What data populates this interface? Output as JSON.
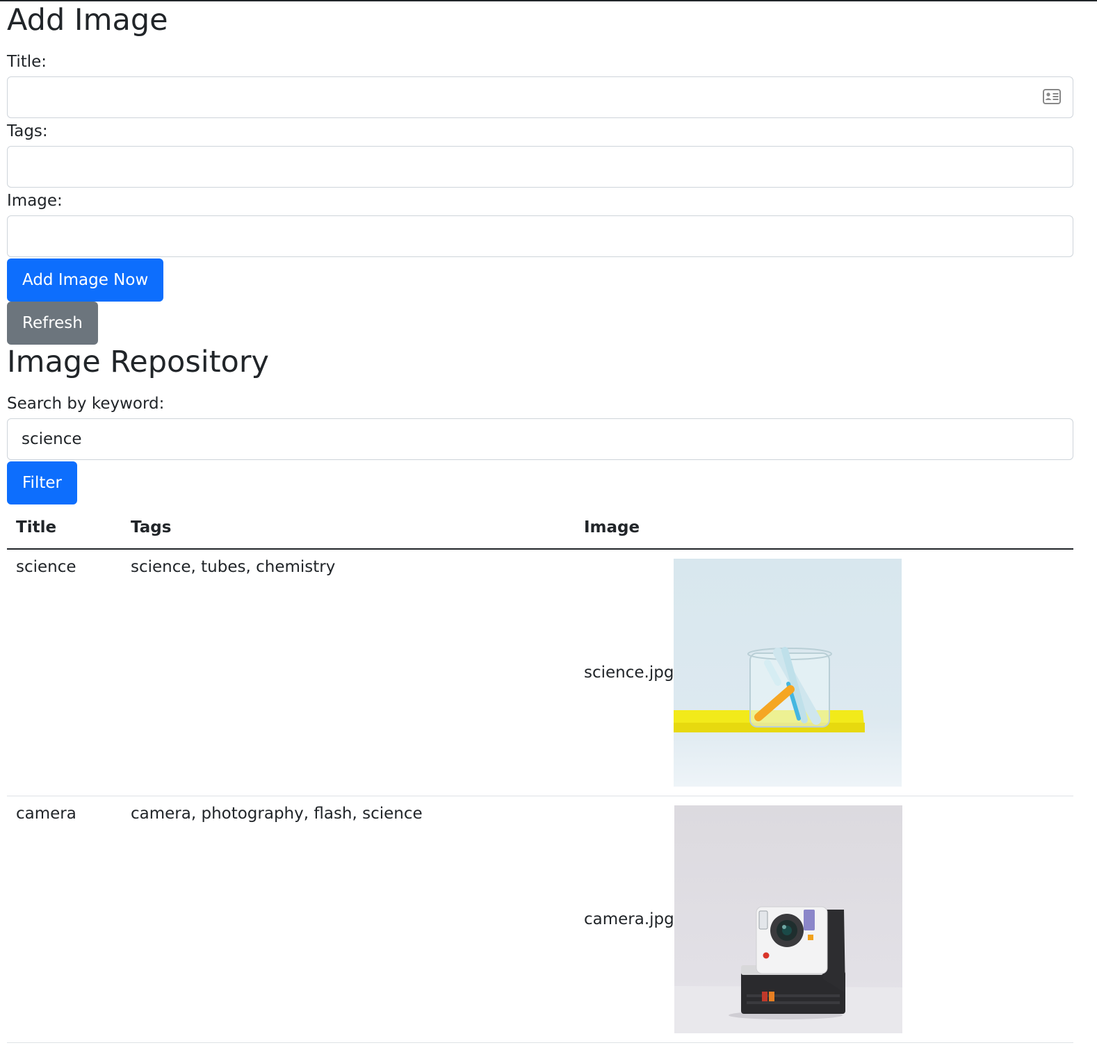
{
  "add_form": {
    "heading": "Add Image",
    "title_label": "Title:",
    "title_value": "",
    "tags_label": "Tags:",
    "tags_value": "",
    "image_label": "Image:",
    "image_value": "",
    "submit_label": "Add Image Now",
    "refresh_label": "Refresh"
  },
  "repository": {
    "heading": "Image Repository",
    "search_label": "Search by keyword:",
    "search_value": "science",
    "filter_label": "Filter",
    "columns": [
      "Title",
      "Tags",
      "Image"
    ],
    "rows": [
      {
        "title": "science",
        "tags": "science, tubes, chemistry",
        "filename": "science.jpg"
      },
      {
        "title": "camera",
        "tags": "camera, photography, flash, science",
        "filename": "camera.jpg"
      }
    ]
  },
  "colors": {
    "primary": "#0d6efd",
    "secondary": "#6c757d",
    "text": "#212529"
  }
}
